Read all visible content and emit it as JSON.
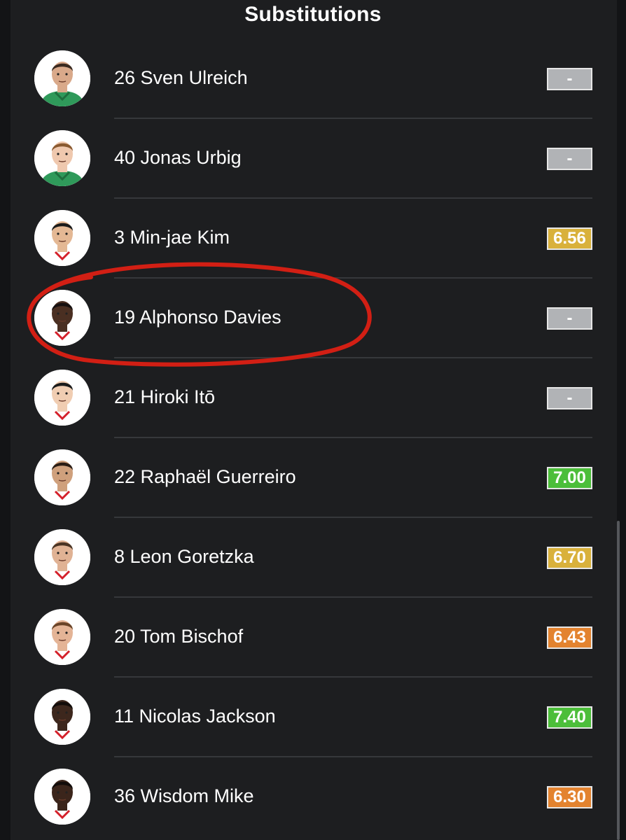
{
  "header": {
    "title": "Substitutions"
  },
  "players": [
    {
      "label": "26 Sven Ulreich",
      "rating": "-",
      "rating_color": "#b1b3b6",
      "kit": "keeper",
      "skin": "#d9a98a",
      "hair": "#3a2a20"
    },
    {
      "label": "40 Jonas Urbig",
      "rating": "-",
      "rating_color": "#b1b3b6",
      "kit": "keeper",
      "skin": "#efc8ae",
      "hair": "#8a5a30"
    },
    {
      "label": "3 Min-jae Kim",
      "rating": "6.56",
      "rating_color": "#d9b13b",
      "kit": "outfield",
      "skin": "#e4b894",
      "hair": "#1b1b1b"
    },
    {
      "label": "19 Alphonso Davies",
      "rating": "-",
      "rating_color": "#b1b3b6",
      "kit": "outfield",
      "skin": "#4a2f22",
      "hair": "#151010"
    },
    {
      "label": "21 Hiroki Itō",
      "rating": "-",
      "rating_color": "#b1b3b6",
      "kit": "outfield",
      "skin": "#f0cdb2",
      "hair": "#1b1b1b"
    },
    {
      "label": "22 Raphaël Guerreiro",
      "rating": "7.00",
      "rating_color": "#4cbe3a",
      "kit": "outfield",
      "skin": "#cfa07c",
      "hair": "#2a1d15"
    },
    {
      "label": "8 Leon Goretzka",
      "rating": "6.70",
      "rating_color": "#d9b13b",
      "kit": "outfield",
      "skin": "#e0b294",
      "hair": "#4a3424"
    },
    {
      "label": "20 Tom Bischof",
      "rating": "6.43",
      "rating_color": "#e3832f",
      "kit": "outfield",
      "skin": "#e4b496",
      "hair": "#6a4428"
    },
    {
      "label": "11 Nicolas Jackson",
      "rating": "7.40",
      "rating_color": "#4cbe3a",
      "kit": "outfield",
      "skin": "#3d271d",
      "hair": "#120c0a"
    },
    {
      "label": "36 Wisdom Mike",
      "rating": "6.30",
      "rating_color": "#e3832f",
      "kit": "outfield",
      "skin": "#3b251b",
      "hair": "#120c0a"
    }
  ],
  "annotation": {
    "shape": "hand-drawn-ellipse",
    "color": "#d21f14",
    "target": "19 Alphonso Davies"
  }
}
